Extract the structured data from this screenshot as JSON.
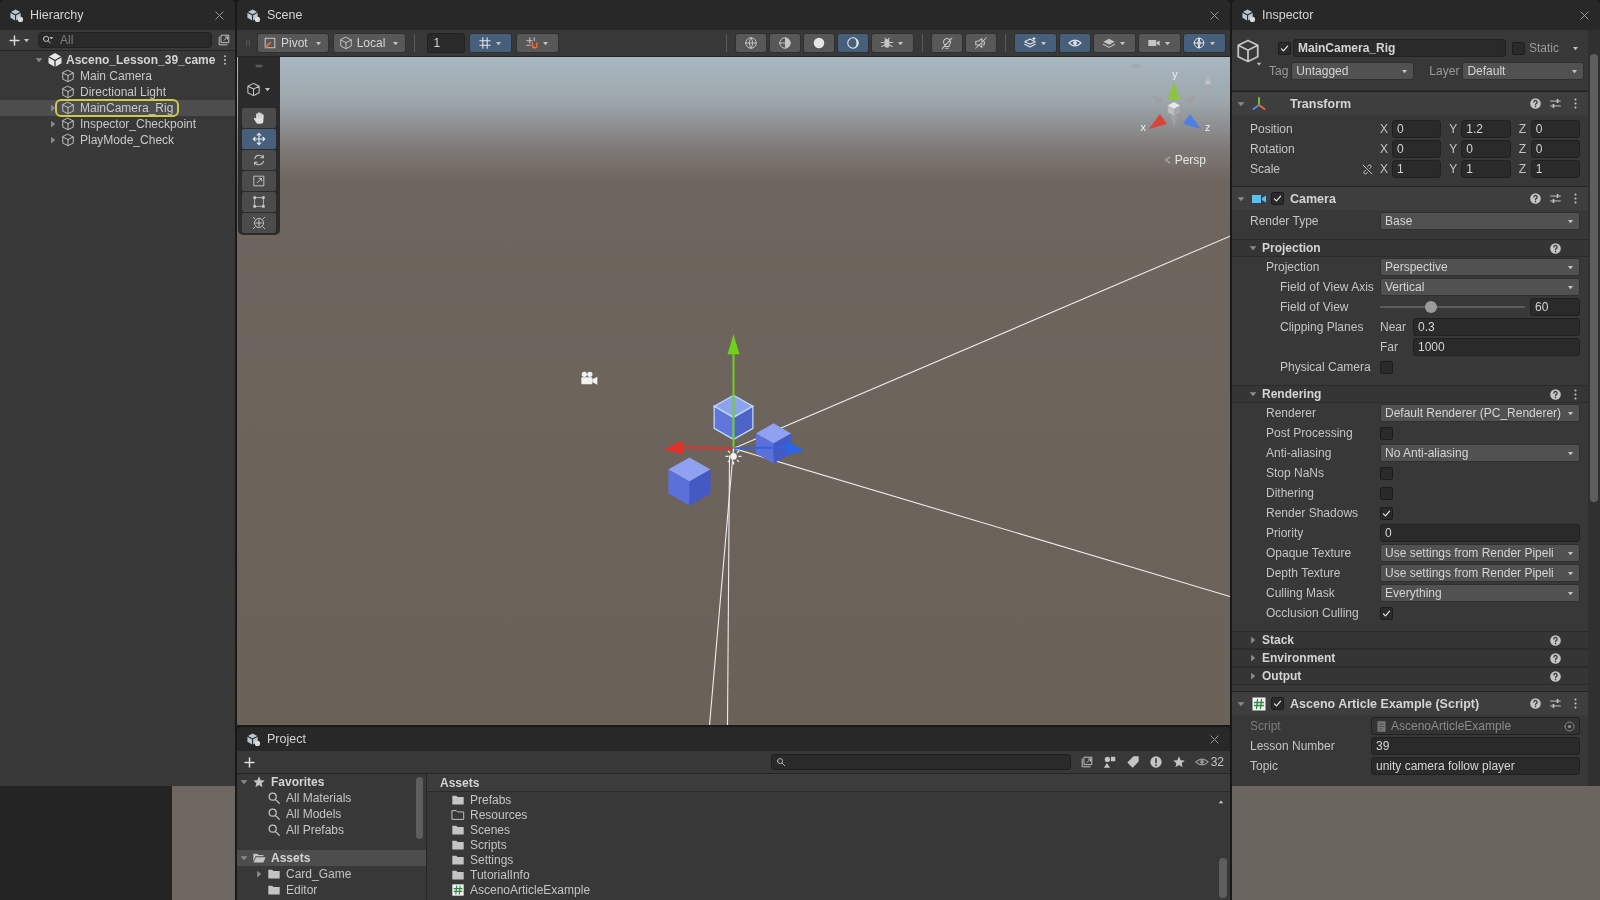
{
  "hierarchy": {
    "title": "Hierarchy",
    "search": {
      "placeholder": "All"
    },
    "root": {
      "name": "Asceno_Lesson_39_came",
      "expanded": true,
      "children": [
        {
          "name": "Main Camera",
          "selected": false,
          "highlighted": false
        },
        {
          "name": "Directional Light",
          "selected": false,
          "highlighted": false
        },
        {
          "name": "MainCamera_Rig",
          "selected": true,
          "highlighted": true,
          "expanded": false
        },
        {
          "name": "Inspector_Checkpoint",
          "selected": false,
          "highlighted": false,
          "expanded": false
        },
        {
          "name": "PlayMode_Check",
          "selected": false,
          "highlighted": false,
          "expanded": false
        }
      ]
    }
  },
  "scene": {
    "title": "Scene",
    "toolbar": {
      "pivot": "Pivot",
      "space": "Local",
      "grid_size": "1",
      "snap_buttons": [
        {
          "kind": "grid_snap",
          "on": true
        },
        {
          "kind": "increment_snap",
          "on": false
        }
      ],
      "button_groups": [
        [
          {
            "kind": "wireframe",
            "on": false
          },
          {
            "kind": "shaded_wireframe",
            "on": false
          },
          {
            "kind": "shaded",
            "on": false
          },
          {
            "kind": "unlit",
            "on": true
          },
          {
            "kind": "debug",
            "on": false
          }
        ],
        [
          {
            "kind": "lighting",
            "on": false
          },
          {
            "kind": "audio",
            "on": false
          }
        ],
        [
          {
            "kind": "effects",
            "on": true
          },
          {
            "kind": "visibility",
            "on": true
          },
          {
            "kind": "layers",
            "on": false
          },
          {
            "kind": "camera",
            "on": false
          },
          {
            "kind": "gizmos",
            "on": true
          }
        ]
      ]
    },
    "tools": [
      {
        "kind": "hand",
        "selected": false
      },
      {
        "kind": "move",
        "selected": true
      },
      {
        "kind": "rotate",
        "selected": false
      },
      {
        "kind": "scale",
        "selected": false
      },
      {
        "kind": "rect",
        "selected": false
      },
      {
        "kind": "transform",
        "selected": false
      }
    ],
    "orientation_gizmo": {
      "axes": [
        {
          "label": "y",
          "color": "#8cc63f"
        },
        {
          "label": "x",
          "color": "#d9443a"
        },
        {
          "label": "z",
          "color": "#4f7fe0"
        }
      ],
      "projection": "Persp"
    }
  },
  "inspector": {
    "title": "Inspector",
    "object": {
      "active": true,
      "name": "MainCamera_Rig",
      "static": false,
      "static_label": "Static",
      "tag_label": "Tag",
      "tag": "Untagged",
      "layer_label": "Layer",
      "layer": "Default"
    },
    "components": [
      {
        "kind": "transform",
        "name": "Transform",
        "expanded": true,
        "rows": [
          {
            "kind": "vector3",
            "label": "Position",
            "axes": [
              {
                "axis": "X",
                "value": "0"
              },
              {
                "axis": "Y",
                "value": "1.2"
              },
              {
                "axis": "Z",
                "value": "0"
              }
            ]
          },
          {
            "kind": "vector3",
            "label": "Rotation",
            "axes": [
              {
                "axis": "X",
                "value": "0"
              },
              {
                "axis": "Y",
                "value": "0"
              },
              {
                "axis": "Z",
                "value": "0"
              }
            ]
          },
          {
            "kind": "vector3",
            "label": "Scale",
            "linked": false,
            "axes": [
              {
                "axis": "X",
                "value": "1"
              },
              {
                "axis": "Y",
                "value": "1"
              },
              {
                "axis": "Z",
                "value": "1"
              }
            ]
          }
        ]
      },
      {
        "kind": "camera",
        "name": "Camera",
        "enabled": true,
        "expanded": true,
        "rows": [
          {
            "kind": "dropdown",
            "label": "Render Type",
            "value": "Base"
          }
        ],
        "sections": [
          {
            "name": "Projection",
            "expanded": true,
            "menu": false,
            "rows": [
              {
                "kind": "dropdown",
                "label": "Projection",
                "value": "Perspective",
                "children": [
                  {
                    "kind": "dropdown",
                    "label": "Field of View Axis",
                    "value": "Vertical"
                  },
                  {
                    "kind": "slider",
                    "label": "Field of View",
                    "level": 0.34,
                    "value": "60"
                  },
                  {
                    "kind": "clipping",
                    "label": "Clipping Planes",
                    "fields": [
                      {
                        "label": "Near",
                        "value": "0.3"
                      },
                      {
                        "label": "Far",
                        "value": "1000"
                      }
                    ]
                  },
                  {
                    "kind": "checkbox",
                    "label": "Physical Camera",
                    "checked": false
                  }
                ]
              }
            ]
          },
          {
            "name": "Rendering",
            "expanded": true,
            "menu": true,
            "rows": [
              {
                "kind": "dropdown",
                "label": "Renderer",
                "value": "Default Renderer (PC_Renderer)"
              },
              {
                "kind": "checkbox",
                "label": "Post Processing",
                "checked": false
              },
              {
                "kind": "dropdown",
                "label": "Anti-aliasing",
                "value": "No Anti-aliasing"
              },
              {
                "kind": "checkbox",
                "label": "Stop NaNs",
                "checked": false
              },
              {
                "kind": "checkbox",
                "label": "Dithering",
                "checked": false
              },
              {
                "kind": "checkbox",
                "label": "Render Shadows",
                "checked": true
              },
              {
                "kind": "text",
                "label": "Priority",
                "value": "0"
              },
              {
                "kind": "dropdown",
                "label": "Opaque Texture",
                "value": "Use settings from Render Pipeli"
              },
              {
                "kind": "dropdown",
                "label": "Depth Texture",
                "value": "Use settings from Render Pipeli"
              },
              {
                "kind": "dropdown",
                "label": "Culling Mask",
                "value": "Everything"
              },
              {
                "kind": "checkbox",
                "label": "Occlusion Culling",
                "checked": true
              }
            ]
          },
          {
            "name": "Stack",
            "expanded": false,
            "menu": false
          },
          {
            "name": "Environment",
            "expanded": false,
            "menu": false
          },
          {
            "name": "Output",
            "expanded": false,
            "menu": false
          }
        ]
      },
      {
        "kind": "script",
        "name": "Asceno Article Example (Script)",
        "enabled": true,
        "expanded": true,
        "rows": [
          {
            "kind": "object",
            "label": "Script",
            "value": "AscenoArticleExample",
            "disabled": true
          },
          {
            "kind": "text",
            "label": "Lesson Number",
            "value": "39",
            "disabled": false
          },
          {
            "kind": "text",
            "label": "Topic",
            "value": "unity camera follow player",
            "disabled": false
          }
        ]
      }
    ]
  },
  "project": {
    "title": "Project",
    "count": "32",
    "tree": [
      {
        "name": "Favorites",
        "kind": "favorites",
        "expanded": true,
        "selected": false,
        "children": [
          {
            "name": "All Materials",
            "kind": "saved_search",
            "selected": false
          },
          {
            "name": "All Models",
            "kind": "saved_search",
            "selected": false
          },
          {
            "name": "All Prefabs",
            "kind": "saved_search",
            "selected": false
          }
        ]
      },
      {
        "name": "Assets",
        "kind": "folder",
        "expanded": true,
        "selected": true,
        "children": [
          {
            "name": "Card_Game",
            "kind": "folder",
            "expanded": false,
            "selected": false
          },
          {
            "name": "Editor",
            "kind": "folder",
            "selected": false
          }
        ]
      }
    ],
    "path": "Assets",
    "items": [
      {
        "name": "Prefabs",
        "kind": "folder",
        "selected": false
      },
      {
        "name": "Resources",
        "kind": "empty_folder",
        "selected": false
      },
      {
        "name": "Scenes",
        "kind": "folder",
        "selected": false
      },
      {
        "name": "Scripts",
        "kind": "folder",
        "selected": false
      },
      {
        "name": "Settings",
        "kind": "folder",
        "selected": false
      },
      {
        "name": "TutorialInfo",
        "kind": "folder",
        "selected": false
      },
      {
        "name": "AscenoArticleExample",
        "kind": "script",
        "selected": false
      }
    ]
  }
}
